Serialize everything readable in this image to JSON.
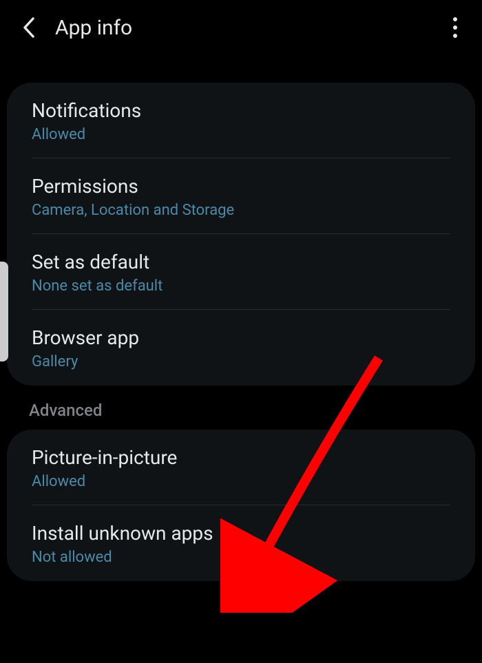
{
  "header": {
    "title": "App info"
  },
  "card1": {
    "notifications": {
      "title": "Notifications",
      "subtitle": "Allowed"
    },
    "permissions": {
      "title": "Permissions",
      "subtitle": "Camera, Location and Storage"
    },
    "setDefault": {
      "title": "Set as default",
      "subtitle": "None set as default"
    },
    "browserApp": {
      "title": "Browser app",
      "subtitle": "Gallery"
    }
  },
  "sectionAdvanced": "Advanced",
  "card2": {
    "pip": {
      "title": "Picture-in-picture",
      "subtitle": "Allowed"
    },
    "installUnknown": {
      "title": "Install unknown apps",
      "subtitle": "Not allowed"
    }
  }
}
